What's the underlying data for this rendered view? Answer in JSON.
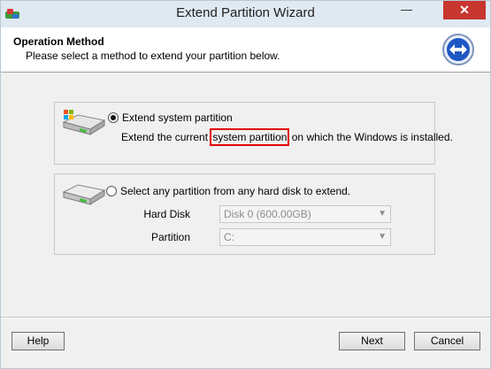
{
  "window": {
    "title": "Extend Partition Wizard",
    "minimize_glyph": "—",
    "close_glyph": "✕"
  },
  "header": {
    "title": "Operation Method",
    "subtitle": "Please select a method to extend your partition below."
  },
  "option_system": {
    "label": "Extend system partition",
    "selected": true,
    "desc_before": "Extend the current ",
    "desc_highlight": "system partition",
    "desc_after": " on which the Windows is installed."
  },
  "option_any": {
    "label": "Select any partition from any hard disk to extend.",
    "selected": false,
    "hard_disk_label": "Hard Disk",
    "hard_disk_value": "Disk 0 (600.00GB)",
    "partition_label": "Partition",
    "partition_value": "C:"
  },
  "buttons": {
    "help": "Help",
    "next": "Next",
    "cancel": "Cancel"
  },
  "colors": {
    "highlight_box": "#e00000",
    "close_button": "#c7362f",
    "titlebar": "#dfe9f2"
  },
  "icons": {
    "app": "wizard-app-icon",
    "header": "extend-arrows-icon",
    "disk_system": "windows-disk-icon",
    "disk_any": "hard-disk-icon",
    "dropdown": "chevron-down-icon"
  }
}
